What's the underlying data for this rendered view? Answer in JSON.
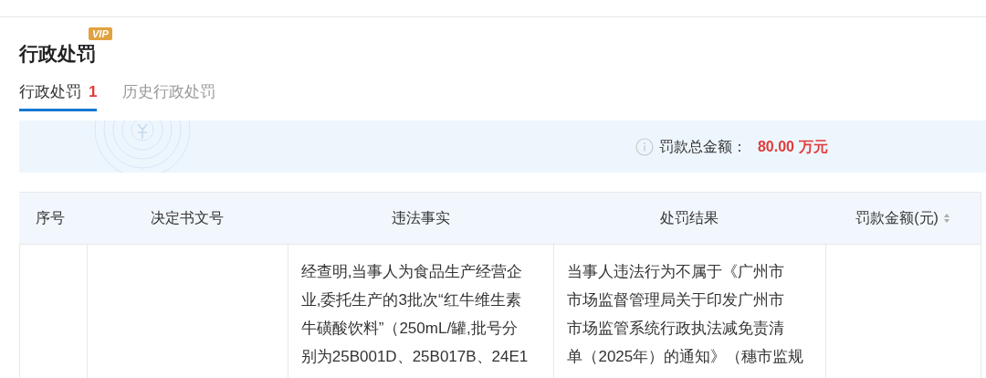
{
  "section": {
    "title": "行政处罚",
    "badge": "VIP"
  },
  "tabs": [
    {
      "label": "行政处罚",
      "count": "1",
      "selected": true
    },
    {
      "label": "历史行政处罚",
      "selected": false
    }
  ],
  "summary": {
    "label": "罚款总金额：",
    "amount": "80.00",
    "unit": "万元"
  },
  "table": {
    "columns": [
      {
        "label": "序号"
      },
      {
        "label": "决定书文号"
      },
      {
        "label": "违法事实"
      },
      {
        "label": "处罚结果"
      },
      {
        "label": "罚款金额(元)",
        "sortable": true
      }
    ],
    "rows": [
      {
        "cells": [
          [],
          [],
          [
            "经查明,当事人为食品生产经营企",
            "业,委托生产的3批次“红牛维生素",
            "牛磺酸饮料”（250mL/罐,批号分",
            "别为25B001D、25B017B、24E1"
          ],
          [
            "当事人违法行为不属于《广州市",
            "市场监督管理局关于印发广州市",
            "市场监管系统行政执法减免责清",
            "单（2025年）的通知》（穗市监规"
          ],
          []
        ]
      }
    ]
  }
}
